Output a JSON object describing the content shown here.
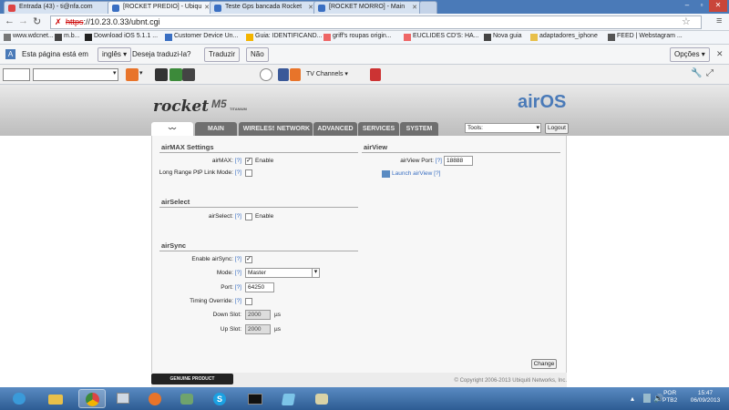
{
  "browser": {
    "tabs": [
      {
        "label": "Entrada (43) - ti@nfa.com",
        "icon": "gmail-icon",
        "color": "#d44"
      },
      {
        "label": "[ROCKET PREDIO] - Ubiqu",
        "icon": "ubiquiti-icon",
        "color": "#3a6fc2"
      },
      {
        "label": "Teste Gps bancada Rocket",
        "icon": "ubiquiti-icon",
        "color": "#3a6fc2"
      },
      {
        "label": "[ROCKET MORRO] - Main",
        "icon": "ubiquiti-icon",
        "color": "#3a6fc2"
      }
    ],
    "address": "https://10.23.0.33/ubnt.cgi",
    "address_scheme": "https",
    "address_rest": "://10.23.0.33/ubnt.cgi",
    "bookmarks": [
      "www.wdcnet...",
      "m.b...",
      "Download iOS 5.1.1 ...",
      "Customer Device Un...",
      "Guia: IDENTIFICAND...",
      "griff's roupas origin...",
      "EUCLIDES CD'S: HA...",
      "Nova guia",
      "adaptadores_iphone",
      "FEED | Webstagram ..."
    ],
    "translate": {
      "prefix": "Esta página está em",
      "language": "inglês",
      "question": "Deseja traduzi-la?",
      "translate_button": "Traduzir",
      "no_button": "Não",
      "options_button": "Opções"
    },
    "toolbar": {
      "tv_channels": "TV Channels"
    }
  },
  "device": {
    "brand": "rocket",
    "model": "M5",
    "variant": "TITANIUM",
    "os_logo": "airOS",
    "tabs": [
      "MAIN",
      "WIRELESS",
      "NETWORK",
      "ADVANCED",
      "SERVICES",
      "SYSTEM"
    ],
    "tools_label": "Tools:",
    "logout_label": "Logout",
    "footer": "© Copyright 2006-2013 Ubiquiti Networks, Inc.",
    "badge": "GENUINE PRODUCT"
  },
  "airmax": {
    "title": "airMAX Settings",
    "airmax_label": "airMAX:",
    "airmax_help": "[?]",
    "airmax_checked": true,
    "airmax_text": "Enable",
    "ptp_label": "Long Range PtP Link Mode:",
    "ptp_help": "[?]",
    "ptp_checked": false
  },
  "airview": {
    "title": "airView",
    "port_label": "airView Port:",
    "port_help": "[?]",
    "port_value": "18888",
    "launch_label": "Launch airView",
    "launch_help": "[?]"
  },
  "airselect": {
    "title": "airSelect",
    "label": "airSelect:",
    "help": "[?]",
    "checked": false,
    "text": "Enable"
  },
  "airsync": {
    "title": "airSync",
    "enable_label": "Enable airSync:",
    "enable_help": "[?]",
    "enable_checked": true,
    "mode_label": "Mode:",
    "mode_help": "[?]",
    "mode_value": "Master",
    "port_label": "Port:",
    "port_help": "[?]",
    "port_value": "64250",
    "timing_label": "Timing Override:",
    "timing_help": "[?]",
    "timing_checked": false,
    "down_label": "Down Slot:",
    "down_value": "2000",
    "down_unit": "µs",
    "up_label": "Up Slot:",
    "up_value": "2000",
    "up_unit": "µs"
  },
  "change_button": "Change",
  "taskbar": {
    "lang": "POR",
    "layout": "PTB2",
    "time": "15:47",
    "date": "06/09/2013"
  }
}
